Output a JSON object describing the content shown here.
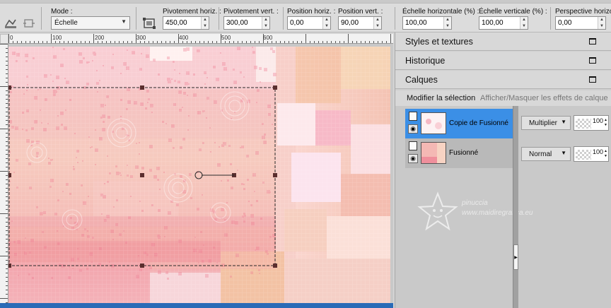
{
  "toolbar": {
    "mode": {
      "label": "Mode :",
      "value": "Échelle"
    },
    "fields": [
      {
        "label": "Pivotement horiz. :",
        "value": "450,00"
      },
      {
        "label": "Pivotement vert. :",
        "value": "300,00"
      },
      {
        "label": "Position horiz. :",
        "value": "0,00"
      },
      {
        "label": "Position vert. :",
        "value": "90,00"
      },
      {
        "label": "Échelle horizontale (%) :",
        "value": "100,00"
      },
      {
        "label": "Échelle verticale (%) :",
        "value": "100,00"
      },
      {
        "label": "Perspective horizon",
        "value": "0,00"
      }
    ]
  },
  "ruler": {
    "h_ticks": [
      "0",
      "100",
      "200",
      "300",
      "400",
      "500",
      "600"
    ]
  },
  "panels": {
    "styles": "Styles et textures",
    "history": "Historique",
    "layers": "Calques",
    "modify_selection": "Modifier la sélection",
    "show_hide_effects": "Afficher/Masquer les effets de calque"
  },
  "layers": [
    {
      "name": "Copie de Fusionné",
      "blend": "Multiplier",
      "opacity": "100",
      "selected": true
    },
    {
      "name": "Fusionné",
      "blend": "Normal",
      "opacity": "100",
      "selected": false
    }
  ],
  "watermark": {
    "line1": "pinuccia",
    "line2": "www.maidiregrafica.eu"
  },
  "colors": {
    "selection": "#3b8fe6",
    "accent": "#2a6bb7"
  }
}
